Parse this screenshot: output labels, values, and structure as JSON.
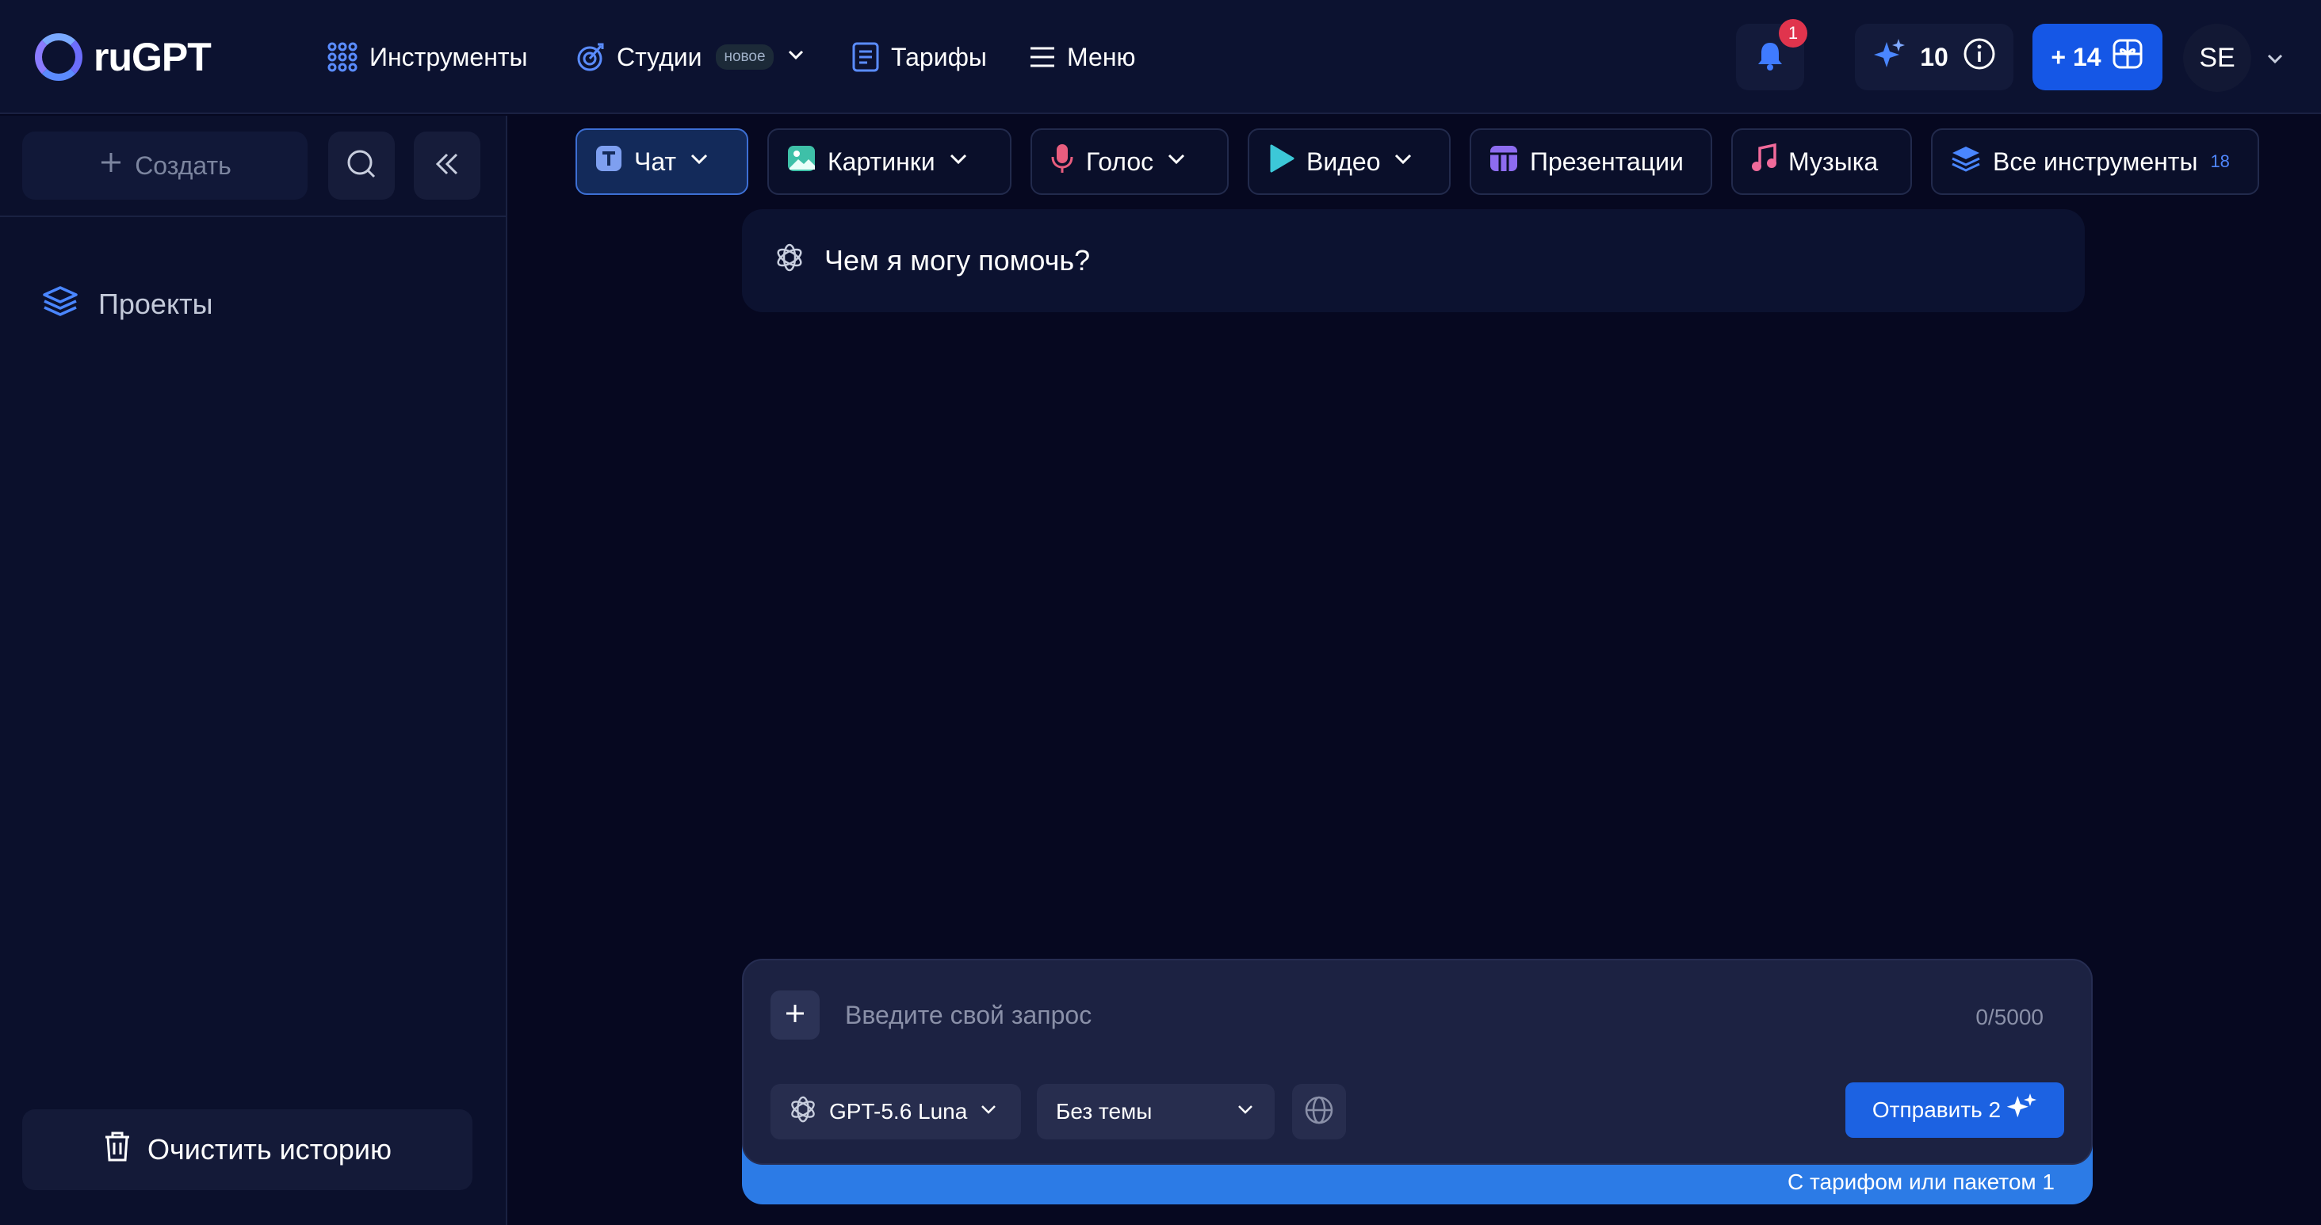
{
  "header": {
    "logo_text": "ruGPT",
    "nav": [
      {
        "label": "Инструменты",
        "icon": "grid-dots-icon"
      },
      {
        "label": "Студии",
        "icon": "studio-icon",
        "badge": "новое"
      },
      {
        "label": "Тарифы",
        "icon": "list-doc-icon"
      },
      {
        "label": "Меню",
        "icon": "hamburger-icon"
      }
    ],
    "notifications_count": "1",
    "credits": "10",
    "bonus": "+ 14",
    "avatar_initials": "SE"
  },
  "sidebar": {
    "create_label": "Создать",
    "projects_label": "Проекты",
    "clear_history_label": "Очистить историю"
  },
  "tools": {
    "tabs": [
      {
        "label": "Чат",
        "icon": "text-t-icon"
      },
      {
        "label": "Картинки",
        "icon": "image-icon"
      },
      {
        "label": "Голос",
        "icon": "microphone-icon"
      },
      {
        "label": "Видео",
        "icon": "play-icon"
      },
      {
        "label": "Презентации",
        "icon": "presentation-icon"
      },
      {
        "label": "Музыка",
        "icon": "music-note-icon"
      },
      {
        "label": "Все инструменты",
        "icon": "layers-icon",
        "count": "18"
      }
    ]
  },
  "chat": {
    "greeting": "Чем я могу помочь?"
  },
  "composer": {
    "placeholder": "Введите свой запрос",
    "char_count": "0/5000",
    "model": "GPT-5.6 Luna",
    "theme": "Без темы",
    "send_label": "Отправить 2",
    "note": "С тарифом или пакетом 1"
  },
  "colors": {
    "background": "#060820",
    "topbar": "#0c1230",
    "accent": "#1557e6",
    "composer_strip": "#2c7be6",
    "notification": "#e0344d"
  }
}
